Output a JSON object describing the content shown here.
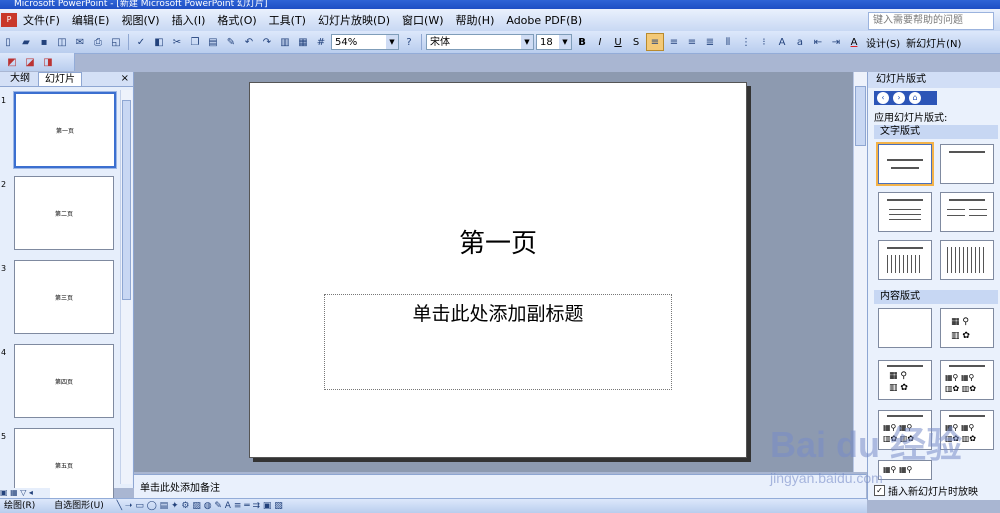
{
  "window": {
    "title": "Microsoft PowerPoint - [新建 Microsoft PowerPoint 幻灯片]"
  },
  "menubar": {
    "items": [
      "文件(F)",
      "编辑(E)",
      "视图(V)",
      "插入(I)",
      "格式(O)",
      "工具(T)",
      "幻灯片放映(D)",
      "窗口(W)",
      "帮助(H)",
      "Adobe PDF(B)"
    ],
    "help_placeholder": "键入需要帮助的问题"
  },
  "toolbar": {
    "zoom": "54%",
    "font": "宋体",
    "font_size": "18",
    "bold": "B",
    "italic": "I",
    "underline": "U",
    "shadow": "S",
    "font_color": "A",
    "design_label": "设计(S)",
    "new_slide_label": "新幻灯片(N)"
  },
  "left_pane": {
    "tab_outline": "大纲",
    "tab_slides": "幻灯片",
    "close": "×",
    "slides": [
      {
        "num": "1",
        "title": "第一页"
      },
      {
        "num": "2",
        "title": "第二页"
      },
      {
        "num": "3",
        "title": "第三页"
      },
      {
        "num": "4",
        "title": "第四页"
      },
      {
        "num": "5",
        "title": "第五页"
      }
    ]
  },
  "slide": {
    "title": "第一页",
    "subtitle_placeholder": "单击此处添加副标题"
  },
  "notes": {
    "placeholder": "单击此处添加备注"
  },
  "task_pane": {
    "header": "幻灯片版式",
    "apply_label": "应用幻灯片版式:",
    "section_text": "文字版式",
    "section_content": "内容版式",
    "insert_check_label": "插入新幻灯片时放映"
  },
  "drawbar": {
    "draw_label": "绘图(R)",
    "autoshape_label": "自选图形(U)"
  },
  "watermark": {
    "logo": "Bai du 经验",
    "url": "jingyan.baidu.com"
  },
  "colors": {
    "accent": "#2c55b7",
    "titlebar": "#1e4fc4"
  }
}
